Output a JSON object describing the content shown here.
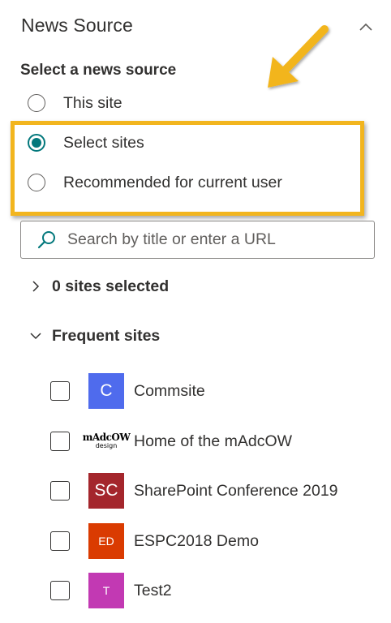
{
  "section": {
    "title": "News Source",
    "collapse_icon": "chevron-up-icon"
  },
  "source_group": {
    "label": "Select a news source",
    "options": [
      {
        "label": "This site",
        "checked": false
      },
      {
        "label": "Select sites",
        "checked": true
      },
      {
        "label": "Recommended for current user",
        "checked": false
      }
    ],
    "accent_color": "#03787c"
  },
  "annotation": {
    "highlight_color": "#f2b51e",
    "arrow_icon": "annotation-arrow-icon"
  },
  "search": {
    "placeholder": "Search by title or enter a URL",
    "value": "",
    "icon": "search-icon",
    "icon_color": "#03787c"
  },
  "selected_sites": {
    "label": "0 sites selected",
    "expanded": false
  },
  "frequent_sites": {
    "label": "Frequent sites",
    "expanded": true,
    "items": [
      {
        "name": "Commsite",
        "logo_text": "C",
        "logo_color": "#4f6bed",
        "checked": false
      },
      {
        "name": "Home of the mAdcOW",
        "logo_text": "mAdcOW",
        "logo_subtext": "design",
        "logo_color": "#ffffff",
        "checked": false
      },
      {
        "name": "SharePoint Conference 2019",
        "logo_text": "SC",
        "logo_color": "#a4262c",
        "checked": false
      },
      {
        "name": "ESPC2018 Demo",
        "logo_text": "ED",
        "logo_color": "#da3b01",
        "checked": false
      },
      {
        "name": "Test2",
        "logo_text": "T",
        "logo_color": "#c239b3",
        "checked": false
      }
    ]
  }
}
